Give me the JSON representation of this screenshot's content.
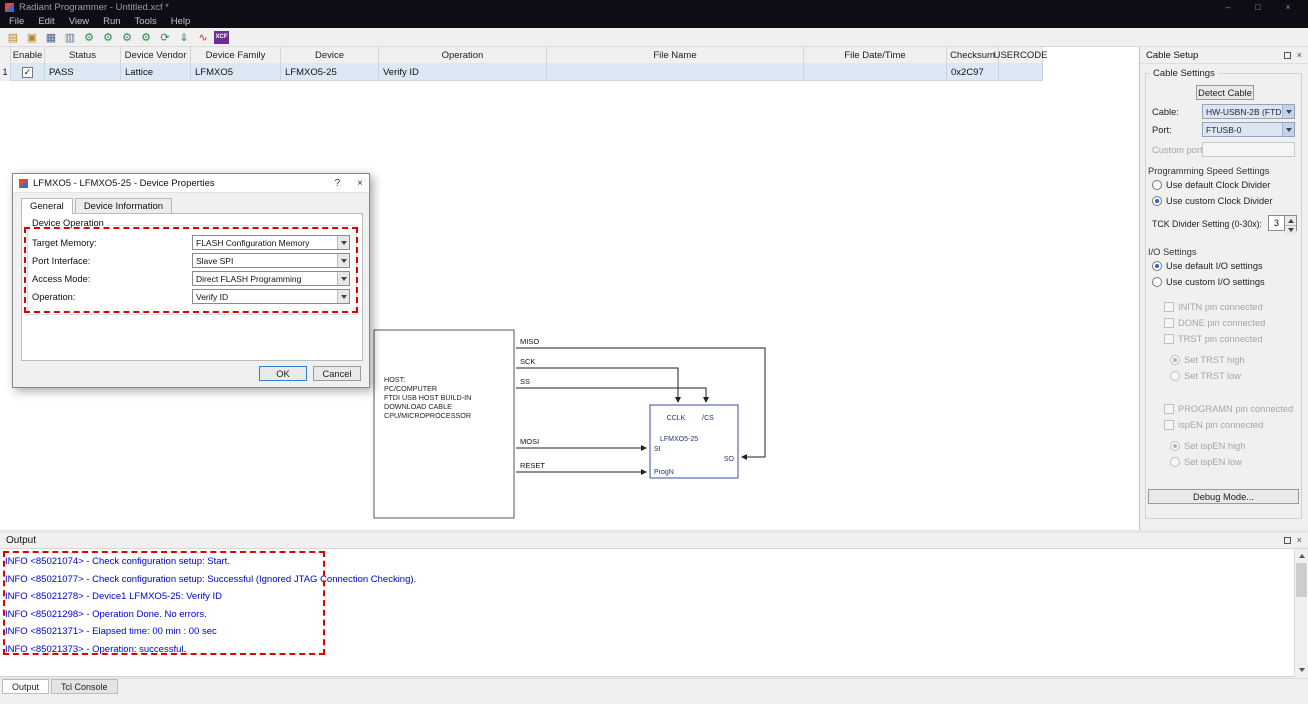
{
  "window": {
    "title": "Radiant Programmer - Untitled.xcf *",
    "minimize": "–",
    "maximize": "□",
    "close": "×"
  },
  "menu": [
    "File",
    "Edit",
    "View",
    "Run",
    "Tools",
    "Help"
  ],
  "toolbar": {
    "icons": [
      {
        "name": "new-project",
        "glyph": "▤"
      },
      {
        "name": "open-project",
        "glyph": "▣"
      },
      {
        "name": "save-project",
        "glyph": "▦"
      },
      {
        "name": "cascade-windows",
        "glyph": "▥"
      },
      {
        "name": "program-device",
        "glyph": "⚙"
      },
      {
        "name": "program-flash",
        "glyph": "⚙"
      },
      {
        "name": "verify-id",
        "glyph": "⚙"
      },
      {
        "name": "erase-device",
        "glyph": "⚙"
      },
      {
        "name": "refresh-devices",
        "glyph": "⟳"
      },
      {
        "name": "download-bitstream",
        "glyph": "⇓"
      },
      {
        "name": "waveform-view",
        "glyph": "∿"
      },
      {
        "name": "xcf-editor",
        "glyph": "XCF"
      }
    ]
  },
  "table": {
    "headers": [
      "Enable",
      "Status",
      "Device Vendor",
      "Device Family",
      "Device",
      "Operation",
      "File Name",
      "File Date/Time",
      "Checksum",
      "USERCODE"
    ],
    "check_glyph": "✓",
    "row": {
      "num": "1",
      "status": "PASS",
      "vendor": "Lattice",
      "family": "LFMXO5",
      "device": "LFMXO5-25",
      "operation": "Verify ID",
      "file_name": "",
      "file_datetime": "",
      "checksum": "0x2C97",
      "usercode": ""
    }
  },
  "dialog": {
    "title": "LFMXO5 - LFMXO5-25 - Device Properties",
    "help": "?",
    "close": "×",
    "tabs": [
      "General",
      "Device Information"
    ],
    "group": "Device Operation",
    "fields": [
      {
        "label": "Target Memory:",
        "value": "FLASH Configuration Memory"
      },
      {
        "label": "Port Interface:",
        "value": "Slave SPI"
      },
      {
        "label": "Access Mode:",
        "value": "Direct FLASH Programming"
      },
      {
        "label": "Operation:",
        "value": "Verify ID"
      }
    ],
    "ok": "OK",
    "cancel": "Cancel"
  },
  "diagram": {
    "host": [
      "HOST:",
      "PC/COMPUTER",
      "FTDI USB HOST BUILD-IN",
      "DOWNLOAD CABLE",
      "CPU/MICROPROCESSOR"
    ],
    "signals": {
      "miso": "MISO",
      "sck": "SCK",
      "ss": "SS",
      "mosi": "MOSI",
      "reset": "RESET"
    },
    "device": {
      "cclk": "CCLK",
      "cs": "/CS",
      "name": "LFMXO5-25",
      "si": "SI",
      "so": "SO",
      "progn": "ProgN"
    }
  },
  "cable_setup": {
    "title": "Cable Setup",
    "group": "Cable Settings",
    "detect": "Detect Cable",
    "cable_label": "Cable:",
    "cable_value": "HW-USBN-2B (FTDI)",
    "port_label": "Port:",
    "port_value": "FTUSB-0",
    "custom_port_label": "Custom port:",
    "speed_section": "Programming Speed Settings",
    "default_clock": "Use default Clock Divider",
    "custom_clock": "Use custom Clock Divider",
    "tck_label": "TCK Divider Setting (0-30x):",
    "tck_value": "3",
    "io_section": "I/O Settings",
    "default_io": "Use default I/O settings",
    "custom_io": "Use custom I/O settings",
    "initn": "INITN pin connected",
    "done": "DONE pin connected",
    "trst": "TRST pin connected",
    "trst_high": "Set TRST high",
    "trst_low": "Set TRST low",
    "programn": "PROGRAMN pin connected",
    "ispen": "ispEN pin connected",
    "ispen_high": "Set ispEN high",
    "ispen_low": "Set ispEN low",
    "debug": "Debug Mode..."
  },
  "output": {
    "title": "Output",
    "lines": [
      "INFO <85021074> - Check configuration setup: Start.",
      "INFO <85021077> - Check configuration setup: Successful (Ignored JTAG Connection Checking).",
      "INFO <85021278> - Device1 LFMXO5-25: Verify ID",
      "INFO <85021298> - Operation Done. No errors.",
      "INFO <85021371> - Elapsed time: 00 min : 00 sec",
      "INFO <85021373> - Operation: successful."
    ],
    "tabs": [
      "Output",
      "Tcl Console"
    ]
  },
  "colors": {
    "annotation_highlight": "#e00000",
    "log_text": "#0000cd",
    "row_background": "#dce9f5",
    "default_button_accent": "#2f7fd6",
    "titlebar_background": "#0d0d16"
  }
}
